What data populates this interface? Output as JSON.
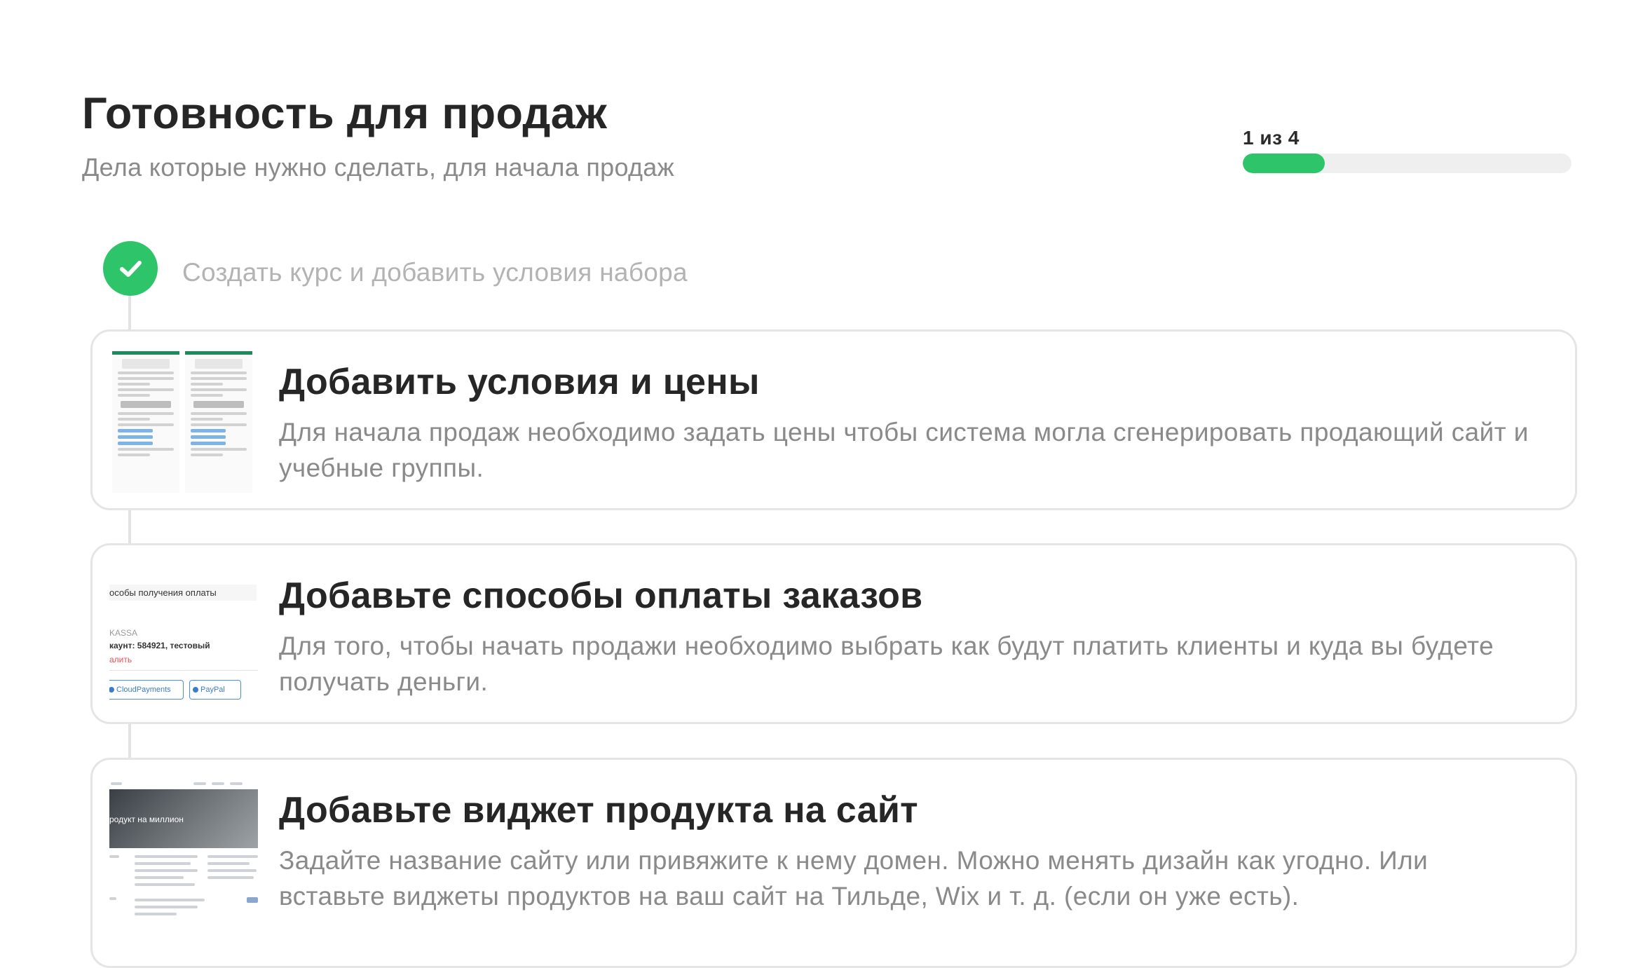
{
  "header": {
    "title": "Готовность для продаж",
    "subtitle": "Дела которые нужно сделать, для начала продаж"
  },
  "progress": {
    "label": "1 из 4",
    "completed": 1,
    "total": 4,
    "color": "#2ec46a"
  },
  "completed_step": {
    "label": "Создать курс и добавить условия набора",
    "icon": "check-icon"
  },
  "tasks": [
    {
      "title": "Добавить условия и цены",
      "description": "Для начала продаж необходимо задать цены чтобы система могла сгенерировать продающий сайт и учебные группы."
    },
    {
      "title": "Добавьте способы оплаты заказов",
      "description": "Для того, чтобы начать продажи необходимо выбрать как будут платить клиенты и куда вы будете получать деньги.",
      "thumb": {
        "heading": "особы получения оплаты",
        "line1": "KASSA",
        "line2": "каунт: 584921, тестовый",
        "line3": "алить",
        "button1": "CloudPayments",
        "button2": "PayPal"
      }
    },
    {
      "title": "Добавьте виджет продукта на сайт",
      "description": "Задайте название сайту или привяжите к нему домен. Можно менять дизайн как угодно. Или вставьте виджеты продуктов на ваш сайт на Тильде, Wix и т. д. (если он уже есть).",
      "thumb": {
        "hero_text": "родукт на миллион"
      }
    }
  ]
}
